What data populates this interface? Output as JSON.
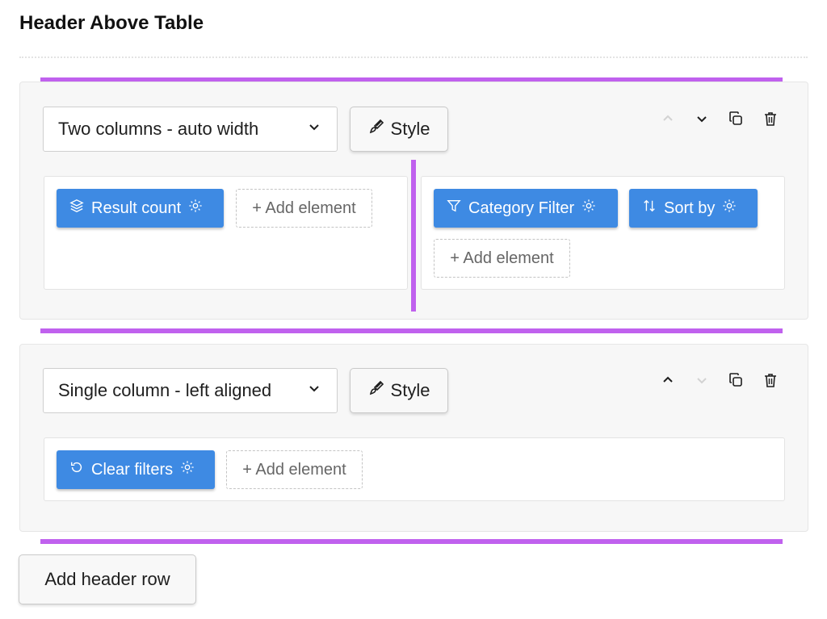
{
  "page": {
    "title": "Header Above Table"
  },
  "rows": [
    {
      "layout_select": "Two columns - auto width",
      "style_label": "Style",
      "columns": [
        {
          "elements": [
            {
              "label": "Result count",
              "icon": "layers-icon"
            }
          ],
          "add_label": "+ Add element"
        },
        {
          "elements": [
            {
              "label": "Category Filter",
              "icon": "filter-icon"
            },
            {
              "label": "Sort by",
              "icon": "sort-icon"
            }
          ],
          "add_label": "+ Add element"
        }
      ],
      "controls": {
        "move_up_enabled": false,
        "move_down_enabled": true
      }
    },
    {
      "layout_select": "Single column - left aligned",
      "style_label": "Style",
      "columns": [
        {
          "elements": [
            {
              "label": "Clear filters",
              "icon": "undo-icon"
            }
          ],
          "add_label": "+ Add element"
        }
      ],
      "controls": {
        "move_up_enabled": true,
        "move_down_enabled": false
      }
    }
  ],
  "add_row_label": "Add header row",
  "colors": {
    "accent": "#3e8ae3",
    "drop_indicator": "#c061ee",
    "panel_bg": "#f7f7f7"
  }
}
